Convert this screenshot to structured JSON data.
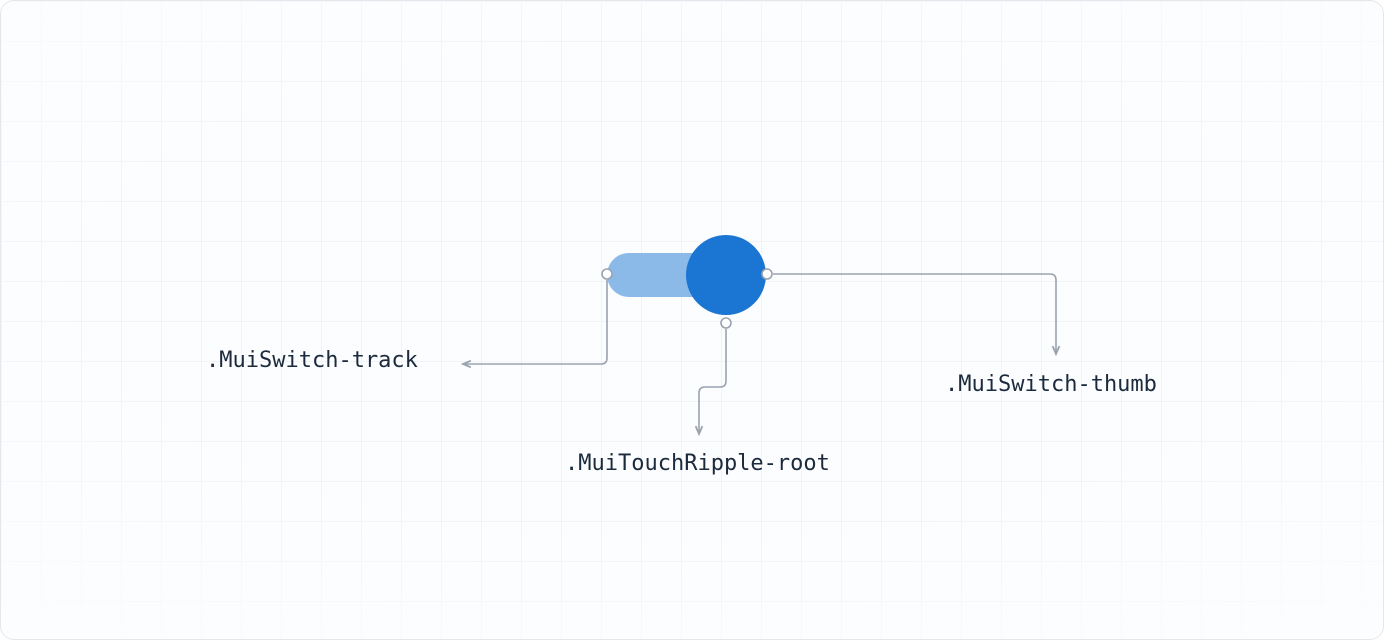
{
  "labels": {
    "track": ".MuiSwitch-track",
    "ripple": ".MuiTouchRipple-root",
    "thumb": ".MuiSwitch-thumb"
  },
  "colors": {
    "thumb": "#1a76d2",
    "track": "#8bb9e8",
    "connector": "#9aa3af",
    "text": "#1b2a3d"
  },
  "component": "MuiSwitch",
  "anatomy_parts": [
    "track",
    "thumb",
    "touchRipple"
  ]
}
